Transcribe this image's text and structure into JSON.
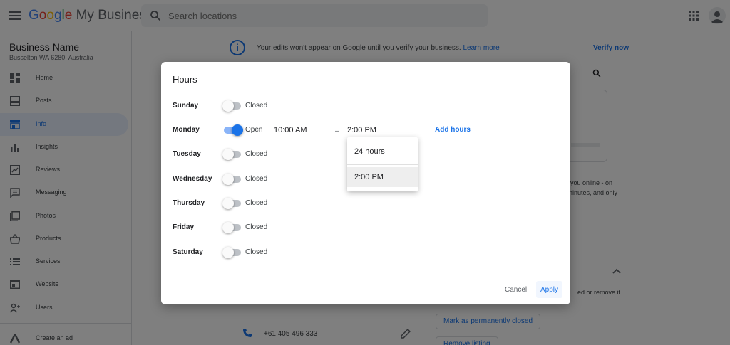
{
  "header": {
    "logo_google": [
      "G",
      "o",
      "o",
      "g",
      "l",
      "e"
    ],
    "logo_rest": " My Business",
    "search_placeholder": "Search locations"
  },
  "sidebar": {
    "business_name": "Business Name",
    "business_address": "Busselton WA 6280, Australia",
    "items": [
      {
        "label": "Home",
        "icon": "home-dashboard-icon"
      },
      {
        "label": "Posts",
        "icon": "posts-icon"
      },
      {
        "label": "Info",
        "icon": "storefront-icon",
        "active": true
      },
      {
        "label": "Insights",
        "icon": "bar-chart-icon"
      },
      {
        "label": "Reviews",
        "icon": "reviews-icon"
      },
      {
        "label": "Messaging",
        "icon": "message-icon"
      },
      {
        "label": "Photos",
        "icon": "photos-icon"
      },
      {
        "label": "Products",
        "icon": "basket-icon"
      },
      {
        "label": "Services",
        "icon": "list-icon"
      },
      {
        "label": "Website",
        "icon": "website-icon"
      },
      {
        "label": "Users",
        "icon": "add-user-icon"
      },
      {
        "label": "Create an ad",
        "icon": "ads-icon"
      }
    ]
  },
  "main": {
    "banner_text": "Your edits won't appear on Google until you verify your business.",
    "banner_link": "Learn more",
    "verify_now": "Verify now",
    "bg_text_1": "you online - on",
    "bg_text_2": "ninutes, and only",
    "bg_text_3": "ed or remove it",
    "phone": "+61 405 496 333",
    "mark_closed": "Mark as permanently closed",
    "remove_listing": "Remove listing"
  },
  "dialog": {
    "title": "Hours",
    "days": [
      {
        "day": "Sunday",
        "status": "Closed",
        "open": false
      },
      {
        "day": "Monday",
        "status": "Open",
        "open": true,
        "open_time": "10:00 AM",
        "close_time": "2:00 PM"
      },
      {
        "day": "Tuesday",
        "status": "Closed",
        "open": false
      },
      {
        "day": "Wednesday",
        "status": "Closed",
        "open": false
      },
      {
        "day": "Thursday",
        "status": "Closed",
        "open": false
      },
      {
        "day": "Friday",
        "status": "Closed",
        "open": false
      },
      {
        "day": "Saturday",
        "status": "Closed",
        "open": false
      }
    ],
    "dash": "–",
    "add_hours": "Add hours",
    "dropdown_options": [
      "24 hours",
      "2:00 PM"
    ],
    "dropdown_selected": "2:00 PM",
    "cancel": "Cancel",
    "apply": "Apply"
  },
  "colors": {
    "accent": "#1a73e8",
    "overlay": "#000000"
  }
}
